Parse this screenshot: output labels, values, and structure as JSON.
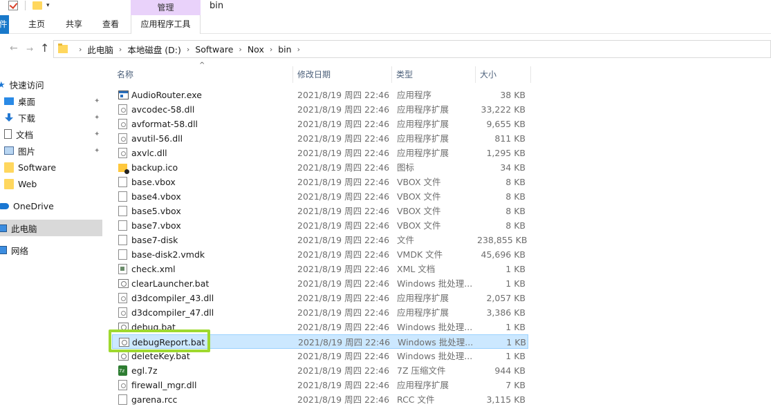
{
  "window": {
    "title": "bin",
    "manage_tab": "管理"
  },
  "ribbon": {
    "file": "件",
    "tabs": [
      "主页",
      "共享",
      "查看",
      "应用程序工具"
    ]
  },
  "address": {
    "crumbs": [
      "此电脑",
      "本地磁盘 (D:)",
      "Software",
      "Nox",
      "bin"
    ]
  },
  "sidebar": {
    "items": [
      {
        "label": "快速访问",
        "icon": "star-icon"
      },
      {
        "label": "桌面",
        "icon": "desktop-icon",
        "pinned": true
      },
      {
        "label": "下载",
        "icon": "download-icon",
        "pinned": true
      },
      {
        "label": "文档",
        "icon": "document-icon",
        "pinned": true
      },
      {
        "label": "图片",
        "icon": "pictures-icon",
        "pinned": true
      },
      {
        "label": "Software",
        "icon": "folder-icon"
      },
      {
        "label": "Web",
        "icon": "folder-icon"
      },
      {
        "label": "OneDrive",
        "icon": "cloud-icon"
      },
      {
        "label": "此电脑",
        "icon": "computer-icon",
        "selected": true
      },
      {
        "label": "网络",
        "icon": "network-icon"
      }
    ]
  },
  "columns": {
    "name": "名称",
    "date": "修改日期",
    "type": "类型",
    "size": "大小"
  },
  "files": [
    {
      "name": "AudioRouter.exe",
      "date": "2021/8/19 周四 22:46",
      "type": "应用程序",
      "size": "38 KB",
      "icon": "exe"
    },
    {
      "name": "avcodec-58.dll",
      "date": "2021/8/19 周四 22:46",
      "type": "应用程序扩展",
      "size": "33,222 KB",
      "icon": "dll"
    },
    {
      "name": "avformat-58.dll",
      "date": "2021/8/19 周四 22:46",
      "type": "应用程序扩展",
      "size": "9,655 KB",
      "icon": "dll"
    },
    {
      "name": "avutil-56.dll",
      "date": "2021/8/19 周四 22:46",
      "type": "应用程序扩展",
      "size": "811 KB",
      "icon": "dll"
    },
    {
      "name": "axvlc.dll",
      "date": "2021/8/19 周四 22:46",
      "type": "应用程序扩展",
      "size": "1,295 KB",
      "icon": "dll"
    },
    {
      "name": "backup.ico",
      "date": "2021/8/19 周四 22:46",
      "type": "图标",
      "size": "34 KB",
      "icon": "ico"
    },
    {
      "name": "base.vbox",
      "date": "2021/8/19 周四 22:46",
      "type": "VBOX 文件",
      "size": "8 KB",
      "icon": "generic"
    },
    {
      "name": "base4.vbox",
      "date": "2021/8/19 周四 22:46",
      "type": "VBOX 文件",
      "size": "8 KB",
      "icon": "generic"
    },
    {
      "name": "base5.vbox",
      "date": "2021/8/19 周四 22:46",
      "type": "VBOX 文件",
      "size": "8 KB",
      "icon": "generic"
    },
    {
      "name": "base7.vbox",
      "date": "2021/8/19 周四 22:46",
      "type": "VBOX 文件",
      "size": "8 KB",
      "icon": "generic"
    },
    {
      "name": "base7-disk",
      "date": "2021/8/19 周四 22:46",
      "type": "文件",
      "size": "238,855 KB",
      "icon": "generic"
    },
    {
      "name": "base-disk2.vmdk",
      "date": "2021/8/19 周四 22:46",
      "type": "VMDK 文件",
      "size": "45,696 KB",
      "icon": "generic"
    },
    {
      "name": "check.xml",
      "date": "2021/8/19 周四 22:46",
      "type": "XML 文档",
      "size": "1 KB",
      "icon": "xml"
    },
    {
      "name": "clearLauncher.bat",
      "date": "2021/8/19 周四 22:46",
      "type": "Windows 批处理...",
      "size": "1 KB",
      "icon": "bat"
    },
    {
      "name": "d3dcompiler_43.dll",
      "date": "2021/8/19 周四 22:46",
      "type": "应用程序扩展",
      "size": "2,057 KB",
      "icon": "dll"
    },
    {
      "name": "d3dcompiler_47.dll",
      "date": "2021/8/19 周四 22:46",
      "type": "应用程序扩展",
      "size": "3,386 KB",
      "icon": "dll"
    },
    {
      "name": "debug.bat",
      "date": "2021/8/19 周四 22:46",
      "type": "Windows 批处理...",
      "size": "1 KB",
      "icon": "bat"
    },
    {
      "name": "debugReport.bat",
      "date": "2021/8/19 周四 22:46",
      "type": "Windows 批处理...",
      "size": "1 KB",
      "icon": "bat",
      "selected": true
    },
    {
      "name": "deleteKey.bat",
      "date": "2021/8/19 周四 22:46",
      "type": "Windows 批处理...",
      "size": "1 KB",
      "icon": "bat"
    },
    {
      "name": "egl.7z",
      "date": "2021/8/19 周四 22:46",
      "type": "7Z 压缩文件",
      "size": "944 KB",
      "icon": "z7"
    },
    {
      "name": "firewall_mgr.dll",
      "date": "2021/8/19 周四 22:46",
      "type": "应用程序扩展",
      "size": "7 KB",
      "icon": "dll"
    },
    {
      "name": "garena.rcc",
      "date": "2021/8/19 周四 22:46",
      "type": "RCC 文件",
      "size": "3,115 KB",
      "icon": "generic"
    }
  ],
  "colors": {
    "selection": "#cce8ff",
    "highlight_box": "#9fd92f",
    "manage_tab": "#e9d2fa",
    "file_tab": "#1979ca"
  }
}
